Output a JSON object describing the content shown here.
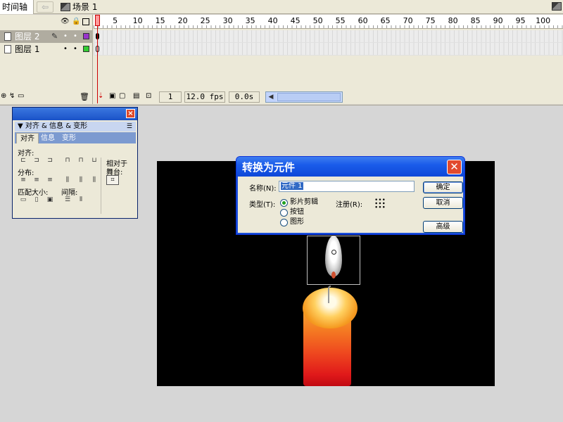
{
  "topbar": {
    "timeline_tab": "时间轴",
    "back_icon": "back-arrow-icon",
    "scene_label": "场景 1"
  },
  "timeline": {
    "ruler": [
      "1",
      "5",
      "10",
      "15",
      "20",
      "25",
      "30",
      "35",
      "40",
      "45",
      "50",
      "55",
      "60",
      "65",
      "70",
      "75",
      "80",
      "85",
      "90",
      "95",
      "100"
    ],
    "layers": [
      {
        "name": "图层 2",
        "selected": true,
        "color": "#9933cc"
      },
      {
        "name": "图层 1",
        "selected": false,
        "color": "#33cc33"
      }
    ],
    "footer": {
      "current_frame": "1",
      "frame_rate": "12.0 fps",
      "elapsed": "0.0s"
    }
  },
  "align_panel": {
    "header": "▼ 对齐 & 信息 & 变形",
    "tabs": [
      "对齐",
      "信息",
      "变形"
    ],
    "label_align": "对齐:",
    "label_distribute": "分布:",
    "label_match_size": "匹配大小:",
    "label_spacing": "间隔:",
    "label_relative": "相对于",
    "label_stage": "舞台:"
  },
  "dialog": {
    "title": "转换为元件",
    "name_label": "名称(N):",
    "name_value": "元件 1",
    "type_label": "类型(T):",
    "register_label": "注册(R):",
    "types": [
      "影片剪辑",
      "按钮",
      "图形"
    ],
    "selected_type": "影片剪辑",
    "buttons": {
      "ok": "确定",
      "cancel": "取消",
      "advanced": "高级"
    }
  },
  "colors": {
    "titlebar": "#1a5cea",
    "stage": "#000000",
    "close": "#e24a2d"
  }
}
